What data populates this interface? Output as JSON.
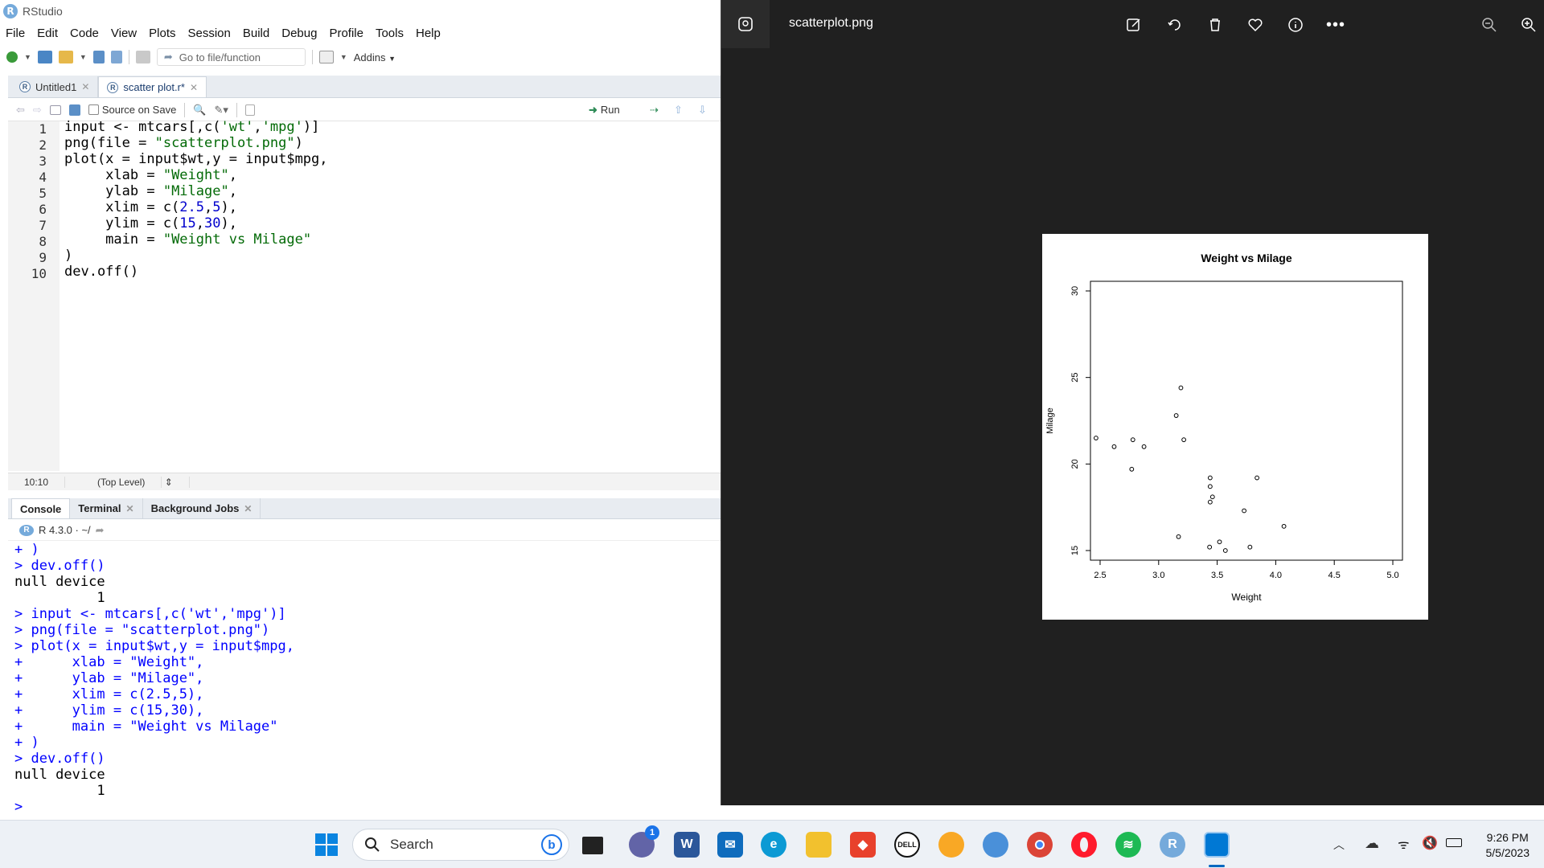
{
  "rstudio": {
    "title": "RStudio",
    "menu": [
      "File",
      "Edit",
      "Code",
      "View",
      "Plots",
      "Session",
      "Build",
      "Debug",
      "Profile",
      "Tools",
      "Help"
    ],
    "toolbar": {
      "goto_placeholder": "Go to file/function",
      "addins_label": "Addins"
    },
    "editor_tabs": [
      {
        "label": "Untitled1"
      },
      {
        "label": "scatter plot.r*"
      }
    ],
    "editor_toolbar": {
      "source_on_save": "Source on Save",
      "run_label": "Run"
    },
    "code_lines": [
      "input <- mtcars[,c('wt','mpg')]",
      "png(file = \"scatterplot.png\")",
      "plot(x = input$wt,y = input$mpg,",
      "     xlab = \"Weight\",",
      "     ylab = \"Milage\",",
      "     xlim = c(2.5,5),",
      "     ylim = c(15,30),",
      "     main = \"Weight vs Milage\"",
      ")",
      "dev.off()"
    ],
    "line_numbers": [
      "1",
      "2",
      "3",
      "4",
      "5",
      "6",
      "7",
      "8",
      "9",
      "10"
    ],
    "status": {
      "position": "10:10",
      "scope": "(Top Level)"
    },
    "console_tabs": [
      "Console",
      "Terminal",
      "Background Jobs"
    ],
    "console_header": "R 4.3.0 · ~/",
    "console_lines": [
      {
        "t": "in",
        "s": "+ )"
      },
      {
        "t": "in",
        "s": "> dev.off()"
      },
      {
        "t": "out",
        "s": "null device"
      },
      {
        "t": "out",
        "s": "          1"
      },
      {
        "t": "in",
        "s": "> input <- mtcars[,c('wt','mpg')]"
      },
      {
        "t": "in",
        "s": "> png(file = \"scatterplot.png\")"
      },
      {
        "t": "in",
        "s": "> plot(x = input$wt,y = input$mpg,"
      },
      {
        "t": "in",
        "s": "+      xlab = \"Weight\","
      },
      {
        "t": "in",
        "s": "+      ylab = \"Milage\","
      },
      {
        "t": "in",
        "s": "+      xlim = c(2.5,5),"
      },
      {
        "t": "in",
        "s": "+      ylim = c(15,30),"
      },
      {
        "t": "in",
        "s": "+      main = \"Weight vs Milage\""
      },
      {
        "t": "in",
        "s": "+ )"
      },
      {
        "t": "in",
        "s": "> dev.off()"
      },
      {
        "t": "out",
        "s": "null device"
      },
      {
        "t": "out",
        "s": "          1"
      },
      {
        "t": "in",
        "s": "> "
      }
    ]
  },
  "viewer": {
    "filename": "scatterplot.png",
    "icons": [
      "edit-icon",
      "rotate-icon",
      "delete-icon",
      "favorite-icon",
      "info-icon",
      "more-icon",
      "zoom-out-icon",
      "zoom-in-icon"
    ]
  },
  "chart_data": {
    "type": "scatter",
    "title": "Weight vs Milage",
    "xlabel": "Weight",
    "ylabel": "Milage",
    "xlim": [
      2.5,
      5
    ],
    "ylim": [
      15,
      30
    ],
    "xticks": [
      "2.5",
      "3.0",
      "3.5",
      "4.0",
      "4.5",
      "5.0"
    ],
    "yticks": [
      "15",
      "20",
      "25",
      "30"
    ],
    "points": [
      [
        2.465,
        21.5
      ],
      [
        2.62,
        21.0
      ],
      [
        2.77,
        19.7
      ],
      [
        2.78,
        21.4
      ],
      [
        2.875,
        21.0
      ],
      [
        3.15,
        22.8
      ],
      [
        3.17,
        15.8
      ],
      [
        3.19,
        24.4
      ],
      [
        3.215,
        21.4
      ],
      [
        3.435,
        15.2
      ],
      [
        3.44,
        18.7
      ],
      [
        3.44,
        19.2
      ],
      [
        3.44,
        17.8
      ],
      [
        3.46,
        18.1
      ],
      [
        3.52,
        15.5
      ],
      [
        3.57,
        15.0
      ],
      [
        3.73,
        17.3
      ],
      [
        3.78,
        15.2
      ],
      [
        3.84,
        19.2
      ],
      [
        4.07,
        16.4
      ]
    ],
    "grid": false
  },
  "taskbar": {
    "search_placeholder": "Search",
    "time": "9:26 PM",
    "date": "5/5/2023",
    "teams_badge": "1",
    "apps": [
      "start-icon",
      "search",
      "task-view-icon",
      "teams-icon",
      "word-icon",
      "mail-icon",
      "edge-icon",
      "file-explorer-icon",
      "git-icon",
      "dell-icon",
      "norton-icon",
      "paint-icon",
      "chrome-icon",
      "opera-icon",
      "spotify-icon",
      "r-icon",
      "photos-icon"
    ],
    "colors": {
      "accent": "#0067c0",
      "spotify": "#1db954",
      "chrome": "#db4437",
      "opera": "#ff1b2d"
    }
  }
}
